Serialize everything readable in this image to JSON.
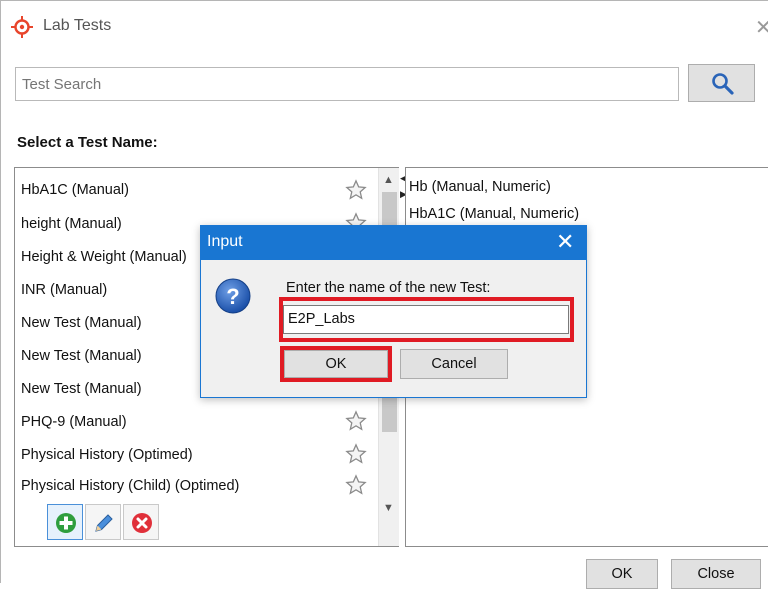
{
  "window": {
    "title": "Lab Tests",
    "close_glyph": "✕"
  },
  "search": {
    "placeholder": "Test Search",
    "button_icon": "search-icon"
  },
  "section_label": "Select a Test Name:",
  "left_list": {
    "items": [
      {
        "label": "HbA1C (Manual)",
        "favorite": false
      },
      {
        "label": "height (Manual)",
        "favorite": false
      },
      {
        "label": "Height & Weight (Manual)",
        "favorite": false
      },
      {
        "label": "INR (Manual)",
        "favorite": false
      },
      {
        "label": "New Test (Manual)",
        "favorite": false
      },
      {
        "label": "New Test (Manual)",
        "favorite": false
      },
      {
        "label": "New Test (Manual)",
        "favorite": false
      },
      {
        "label": "PHQ-9 (Manual)",
        "favorite": false
      },
      {
        "label": "Physical History (Optimed)",
        "favorite": false
      },
      {
        "label": "Physical History (Child) (Optimed)",
        "favorite": false
      }
    ]
  },
  "toolbar": {
    "add_icon": "add-icon",
    "edit_icon": "pencil-icon",
    "delete_icon": "delete-icon"
  },
  "right_list": {
    "items": [
      "Hb (Manual, Numeric)",
      "HbA1C (Manual, Numeric)"
    ]
  },
  "footer": {
    "ok_label": "OK",
    "close_label": "Close"
  },
  "dialog": {
    "title": "Input",
    "close_glyph": "✕",
    "prompt": "Enter the name of the new Test:",
    "input_value": "E2P_Labs",
    "ok_label": "OK",
    "cancel_label": "Cancel",
    "icon": "question-icon"
  },
  "colors": {
    "dialog_titlebar": "#1976d2",
    "highlight": "#e01b24",
    "app_icon": "#e8452c"
  }
}
